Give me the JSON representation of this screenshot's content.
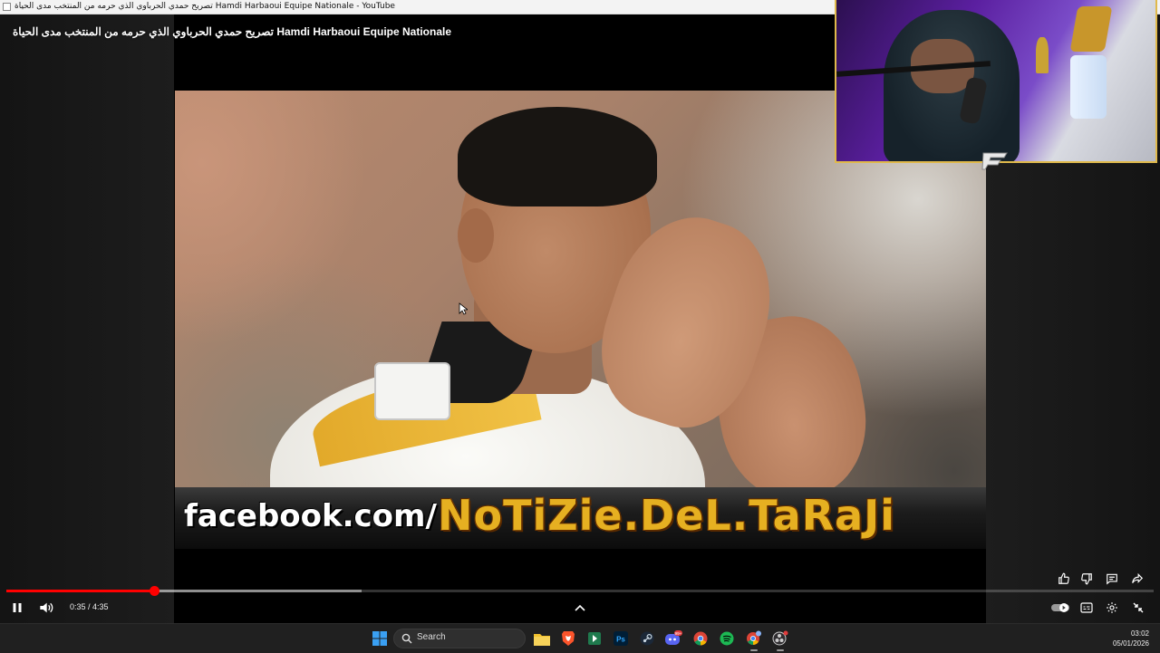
{
  "window": {
    "title": "تصريح حمدي الحرباوي الذي حرمه من المنتخب مدى الحياة Hamdi Harbaoui Equipe Nationale - YouTube"
  },
  "video": {
    "title": "تصريح حمدي الحرباوي الذي حرمه من المنتخب مدى الحياة Hamdi Harbaoui Equipe Nationale",
    "overlay_prefix": "facebook.com/",
    "overlay_page": "NoTiZie.DeL.TaRaJi"
  },
  "player": {
    "progress_fraction": 0.1287,
    "buffer_fraction": 0.31,
    "time_display": "0:35 / 4:35",
    "actions": [
      "like-icon",
      "dislike-icon",
      "comments-icon",
      "share-icon"
    ],
    "controls": [
      "pause-icon",
      "volume-icon",
      "chevron-up-icon",
      "autoplay-toggle",
      "captions-icon",
      "settings-icon",
      "exit-fullscreen-icon"
    ]
  },
  "taskbar": {
    "search_label": "Search",
    "clock_time": "03:02",
    "clock_date": "05/01/2026",
    "apps": [
      "windows-start-icon",
      "file-explorer-icon",
      "brave-browser-icon",
      "download-app-icon",
      "photoshop-icon",
      "steam-icon",
      "discord-icon",
      "chrome-icon",
      "spotify-icon",
      "chrome-profile-icon",
      "obs-icon"
    ],
    "photoshop_label": "Ps",
    "discord_badge": "99+"
  },
  "colors": {
    "progress": "#ff0000",
    "overlay_gold": "#e6b021",
    "webcam_border": "#e0b94b",
    "taskbar_bg": "#202020"
  }
}
